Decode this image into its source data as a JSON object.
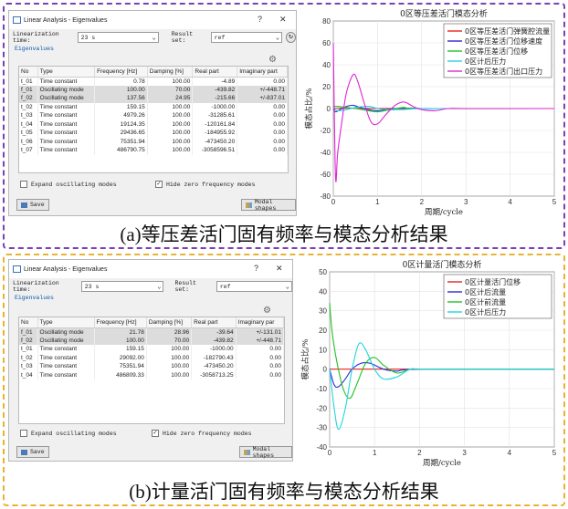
{
  "panels": [
    {
      "caption": "(a)等压差活门固有频率与模态分析结果",
      "dialog": {
        "title": "Linear Analysis - Eigenvalues",
        "help": "?",
        "close": "✕",
        "linearization_label": "Linearization time:",
        "linearization_value": "23 s",
        "result_label": "Result set:",
        "result_value": "ref",
        "section": "Eigenvalues",
        "columns": [
          "No",
          "Type",
          "Frequency [Hz]",
          "Damping [%]",
          "Real part",
          "Imaginary part"
        ],
        "rows": [
          [
            "t_01",
            "Time constant",
            "0.78",
            "100.00",
            "-4.89",
            "0.00"
          ],
          [
            "f_01",
            "Oscillating mode",
            "100.00",
            "70.00",
            "-439.82",
            "+/-448.71"
          ],
          [
            "f_02",
            "Oscillating mode",
            "137.56",
            "24.95",
            "-215.66",
            "+/-837.01"
          ],
          [
            "t_02",
            "Time constant",
            "159.15",
            "100.00",
            "-1000.00",
            "0.00"
          ],
          [
            "t_03",
            "Time constant",
            "4979.26",
            "100.00",
            "-31285.61",
            "0.00"
          ],
          [
            "t_04",
            "Time constant",
            "19124.35",
            "100.00",
            "-120161.84",
            "0.00"
          ],
          [
            "t_05",
            "Time constant",
            "29436.65",
            "100.00",
            "-184955.92",
            "0.00"
          ],
          [
            "t_06",
            "Time constant",
            "75351.94",
            "100.00",
            "-473450.20",
            "0.00"
          ],
          [
            "t_07",
            "Time constant",
            "486790.75",
            "100.00",
            "-3058596.51",
            "0.00"
          ]
        ],
        "selected_rows": [
          1,
          2
        ],
        "expand_label": "Expand oscillating modes",
        "expand_checked": false,
        "hide_label": "Hide zero frequency modes",
        "hide_checked": true,
        "save_label": "Save",
        "modal_label": "Modal shapes"
      }
    },
    {
      "caption": "(b)计量活门固有频率与模态分析结果",
      "dialog": {
        "title": "Linear Analysis - Eigenvalues",
        "help": "?",
        "close": "✕",
        "linearization_label": "Linearization time:",
        "linearization_value": "23 s",
        "result_label": "Result set:",
        "result_value": "ref",
        "section": "Eigenvalues",
        "columns": [
          "No",
          "Type",
          "Frequency [Hz]",
          "Damping [%]",
          "Real part",
          "Imaginary par"
        ],
        "rows": [
          [
            "f_01",
            "Oscillating mode",
            "21.78",
            "28.96",
            "-39.64",
            "+/-131.01"
          ],
          [
            "f_02",
            "Oscillating mode",
            "100.00",
            "70.00",
            "-439.82",
            "+/-448.71"
          ],
          [
            "t_01",
            "Time constant",
            "159.15",
            "100.00",
            "-1000.00",
            "0.00"
          ],
          [
            "t_02",
            "Time constant",
            "29092.00",
            "100.00",
            "-182790.43",
            "0.00"
          ],
          [
            "t_03",
            "Time constant",
            "75351.94",
            "100.00",
            "-473450.20",
            "0.00"
          ],
          [
            "t_04",
            "Time constant",
            "486809.33",
            "100.00",
            "-3058713.25",
            "0.00"
          ]
        ],
        "selected_rows": [
          0,
          1
        ],
        "expand_label": "Expand oscillating modes",
        "expand_checked": false,
        "hide_label": "Hide zero frequency modes",
        "hide_checked": true,
        "save_label": "Save",
        "modal_label": "Modal shapes"
      }
    }
  ],
  "chart_data": [
    {
      "type": "line",
      "title": "0区等压差活门模态分析",
      "xlabel": "周期/cycle",
      "ylabel": "模态占比/%",
      "xlim": [
        0,
        5
      ],
      "ylim": [
        -80,
        80
      ],
      "xticks": [
        0,
        1,
        2,
        3,
        4,
        5
      ],
      "yticks": [
        -80,
        -60,
        -40,
        -20,
        0,
        20,
        40,
        60,
        80
      ],
      "grid": true,
      "legend_position": "top-right",
      "series": [
        {
          "name": "0区等压差活门弹簧腔流量",
          "color": "#e8221c",
          "x": [
            0,
            0.1,
            0.3,
            0.5,
            1,
            2,
            3,
            5
          ],
          "y": [
            0,
            0.2,
            0.4,
            0.2,
            0.1,
            0,
            0,
            0
          ]
        },
        {
          "name": "0区等压差活门位移速度",
          "color": "#2a2ad6",
          "x": [
            0,
            0.05,
            0.15,
            0.3,
            0.45,
            0.6,
            0.8,
            1.0,
            1.3,
            1.6,
            2.0,
            2.5,
            5
          ],
          "y": [
            0,
            -3,
            -1,
            2,
            3,
            1,
            -1,
            -2,
            -0.5,
            0.5,
            0,
            0,
            0
          ]
        },
        {
          "name": "0区等压差活门位移",
          "color": "#22c222",
          "x": [
            0,
            0.1,
            0.3,
            0.5,
            0.8,
            1.0,
            1.3,
            1.6,
            2.0,
            5
          ],
          "y": [
            2,
            2,
            1,
            0,
            -2,
            -3,
            -1,
            1,
            0,
            0
          ]
        },
        {
          "name": "0区计后压力",
          "color": "#22d4e0",
          "x": [
            0,
            0.1,
            0.3,
            0.5,
            0.8,
            1.0,
            1.2,
            1.5,
            2.0,
            2.5,
            5
          ],
          "y": [
            0,
            -2,
            -1,
            1,
            2,
            0,
            -1,
            -1,
            0,
            0,
            0
          ]
        },
        {
          "name": "0区等压差活门出口压力",
          "color": "#e026d6",
          "x": [
            0,
            0.05,
            0.1,
            0.2,
            0.3,
            0.45,
            0.55,
            0.7,
            0.85,
            1.0,
            1.2,
            1.4,
            1.6,
            1.8,
            2.0,
            2.3,
            2.6,
            3.0,
            5
          ],
          "y": [
            60,
            -62,
            -40,
            -10,
            15,
            31,
            25,
            5,
            -12,
            -14,
            -5,
            3,
            6,
            2,
            -1,
            -2,
            0,
            0,
            0
          ]
        }
      ]
    },
    {
      "type": "line",
      "title": "0区计量活门模态分析",
      "xlabel": "周期/cycle",
      "ylabel": "模态占比/%",
      "xlim": [
        0,
        5
      ],
      "ylim": [
        -40,
        50
      ],
      "xticks": [
        0,
        1,
        2,
        3,
        4,
        5
      ],
      "yticks": [
        -40,
        -30,
        -20,
        -10,
        0,
        10,
        20,
        30,
        40,
        50
      ],
      "grid": true,
      "legend_position": "top-right",
      "series": [
        {
          "name": "0区计量活门位移",
          "color": "#e8221c",
          "x": [
            0,
            5
          ],
          "y": [
            0,
            0
          ]
        },
        {
          "name": "0区计后流量",
          "color": "#2a2ad6",
          "x": [
            0,
            0.1,
            0.2,
            0.35,
            0.5,
            0.7,
            0.9,
            1.2,
            1.5,
            2.0,
            5
          ],
          "y": [
            0,
            -8,
            -9,
            -5,
            0,
            3,
            3,
            0,
            -1,
            0,
            0
          ]
        },
        {
          "name": "0区计前流量",
          "color": "#22c222",
          "x": [
            0,
            0.05,
            0.15,
            0.3,
            0.45,
            0.6,
            0.8,
            1.0,
            1.2,
            1.5,
            1.8,
            2.2,
            5
          ],
          "y": [
            34,
            20,
            5,
            -10,
            -15,
            -8,
            3,
            6,
            2,
            -2,
            0,
            0,
            0
          ]
        },
        {
          "name": "0区计后压力",
          "color": "#22d4e0",
          "x": [
            0,
            0.1,
            0.2,
            0.35,
            0.5,
            0.65,
            0.8,
            1.0,
            1.2,
            1.5,
            1.8,
            2.2,
            5
          ],
          "y": [
            0,
            -20,
            -31,
            -20,
            0,
            13,
            10,
            0,
            -5,
            -4,
            0,
            0,
            0
          ]
        }
      ]
    }
  ]
}
